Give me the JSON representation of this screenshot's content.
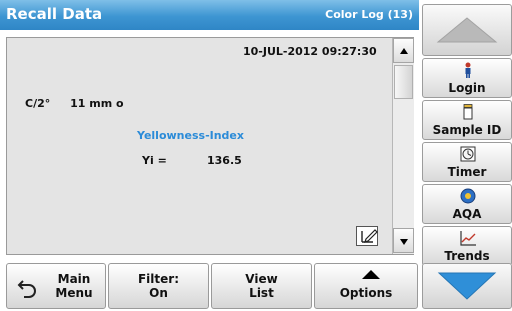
{
  "header": {
    "title": "Recall Data",
    "log_label": "Color Log (13)"
  },
  "record": {
    "datetime": "10-JUL-2012  09:27:30",
    "c_label": "C/2°",
    "c_value": "11 mm o",
    "index_title": "Yellowness-Index",
    "yi_label": "Yi =",
    "yi_value": "136.5"
  },
  "side": {
    "login": "Login",
    "sample_id": "Sample ID",
    "timer": "Timer",
    "aqa": "AQA",
    "trends": "Trends"
  },
  "bottom": {
    "main_menu_1": "Main",
    "main_menu_2": "Menu",
    "filter_1": "Filter:",
    "filter_2": "On",
    "view_1": "View",
    "view_2": "List",
    "options": "Options"
  },
  "icons": {
    "back": "back-arrow-icon",
    "edit": "edit-icon",
    "login": "person-icon",
    "sample": "sample-bottle-icon",
    "timer": "timer-icon",
    "aqa": "aqa-icon",
    "trends": "trend-chart-icon"
  },
  "colors": {
    "title_bar": "#3d95d2",
    "index_title": "#2b8bd8",
    "nav_arrow": "#2f8fd8"
  }
}
